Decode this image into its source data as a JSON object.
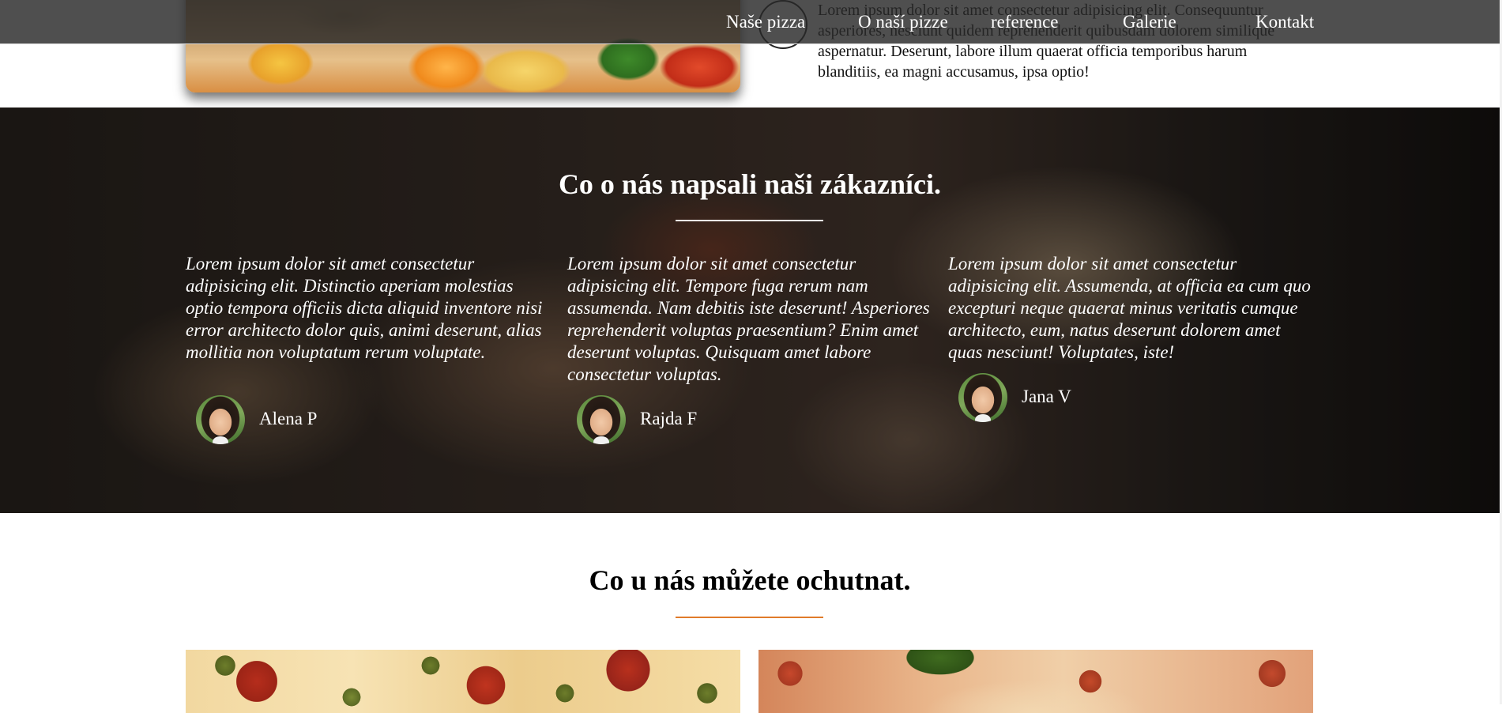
{
  "nav": {
    "items": [
      {
        "label": "Naše pizza"
      },
      {
        "label": "O naší pizze"
      },
      {
        "label": "reference"
      },
      {
        "label": "Galerie"
      },
      {
        "label": "Kontakt"
      }
    ]
  },
  "about": {
    "text": "Lorem ipsum dolor sit amet consectetur adipisicing elit. Consequuntur asperiores, nesciunt quidem reprehenderit quibusdam dolorem similique aspernatur. Deserunt, labore illum quaerat officia temporibus harum blanditiis, ea magni accusamus, ipsa optio!"
  },
  "testimonials": {
    "title": "Co o nás napsali naši zákazníci.",
    "underline_color": "#ffffff",
    "items": [
      {
        "quote": "Lorem ipsum dolor sit amet consectetur adipisicing elit. Distinctio aperiam molestias optio tempora officiis dicta aliquid inventore nisi error architecto dolor quis, animi deserunt, alias mollitia non voluptatum rerum voluptate.",
        "name": "Alena P"
      },
      {
        "quote": "Lorem ipsum dolor sit amet consectetur adipisicing elit. Tempore fuga rerum nam assumenda. Nam debitis iste deserunt! Asperiores reprehenderit voluptas praesentium? Enim amet deserunt voluptas. Quisquam amet labore consectetur voluptas.",
        "name": "Rajda F"
      },
      {
        "quote": "Lorem ipsum dolor sit amet consectetur adipisicing elit. Assumenda, at officia ea cum quo excepturi neque quaerat minus veritatis cumque architecto, eum, natus deserunt dolorem amet quas nesciunt! Voluptates, iste!",
        "name": "Jana V"
      }
    ]
  },
  "menu": {
    "title": "Co u nás můžete ochutnat.",
    "underline_color": "#e07b2a"
  }
}
